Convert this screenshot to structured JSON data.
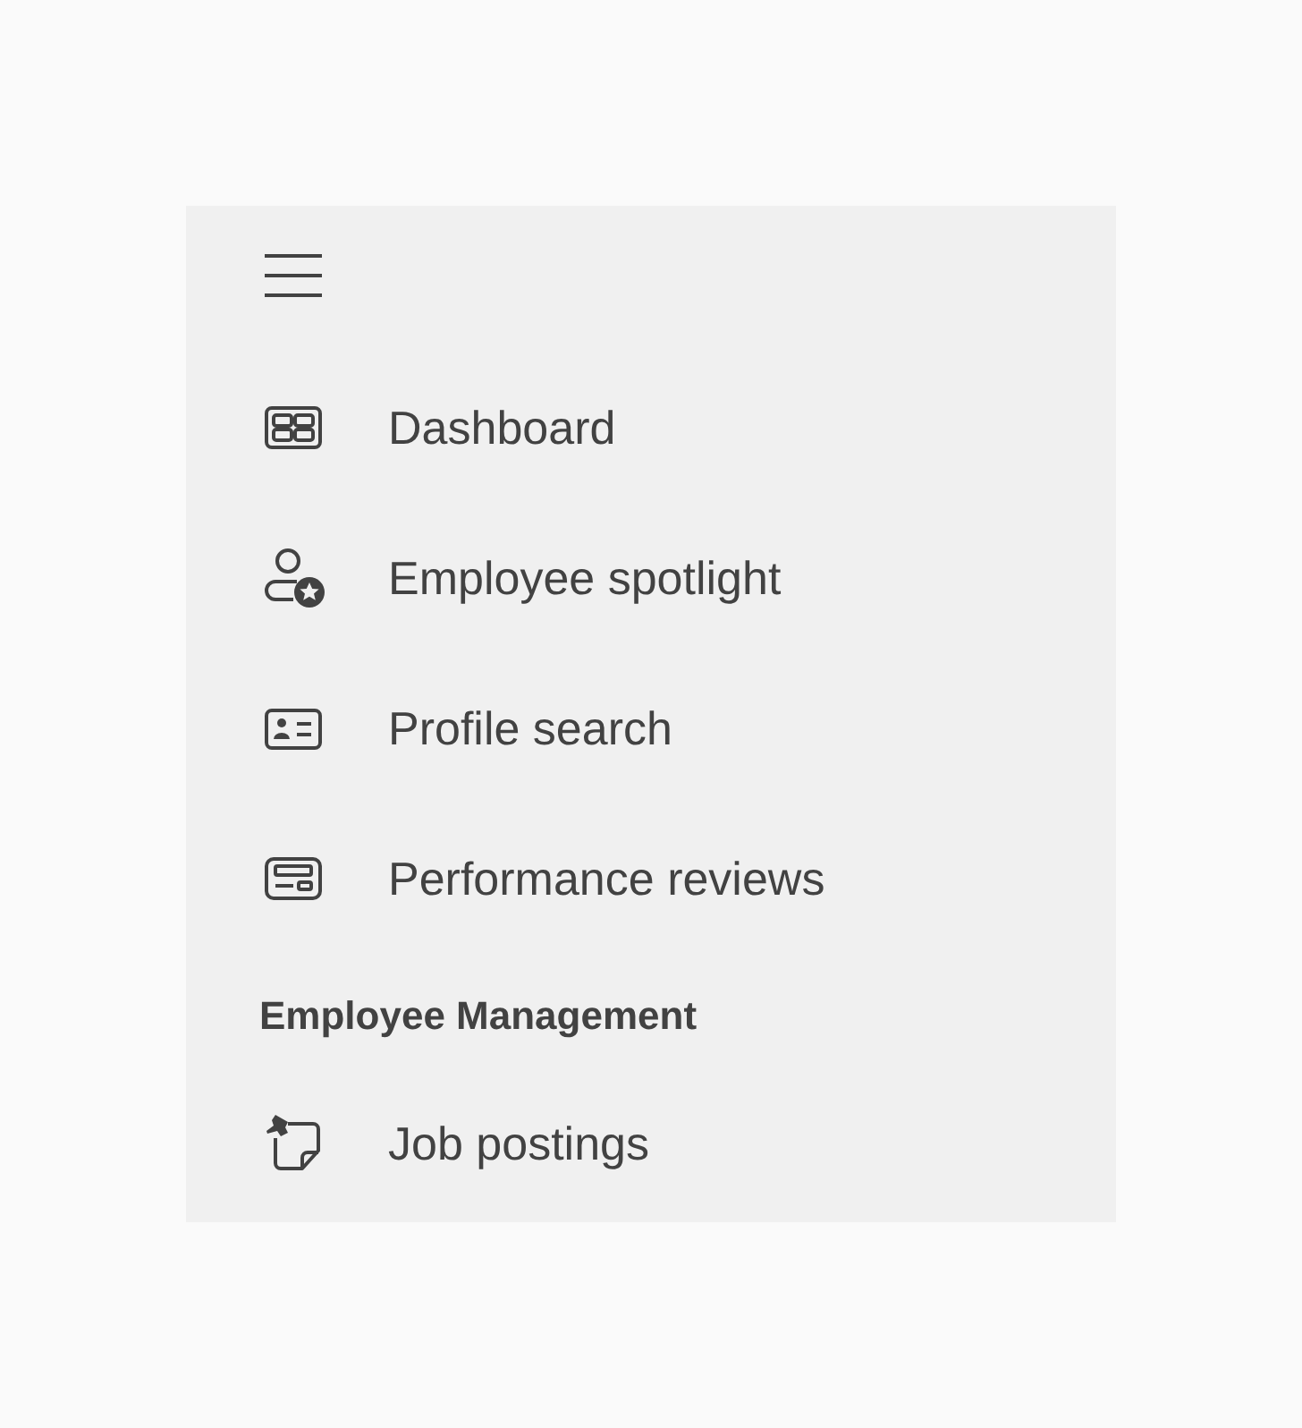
{
  "nav_groups": [
    {
      "items": [
        {
          "label": "Dashboard"
        },
        {
          "label": "Employee spotlight"
        },
        {
          "label": "Profile search"
        },
        {
          "label": "Performance reviews"
        }
      ]
    },
    {
      "header": "Employee Management",
      "items": [
        {
          "label": "Job postings"
        }
      ]
    }
  ]
}
